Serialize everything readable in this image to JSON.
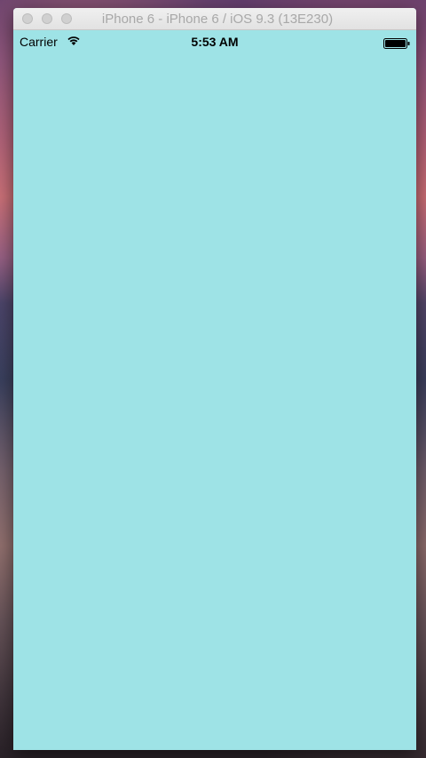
{
  "window": {
    "title": "iPhone 6 - iPhone 6 / iOS 9.3 (13E230)"
  },
  "status_bar": {
    "carrier": "Carrier",
    "time": "5:53 AM",
    "wifi_icon": "wifi-icon",
    "battery_icon": "battery-icon"
  },
  "app": {
    "background_color": "#9ee3e6"
  }
}
